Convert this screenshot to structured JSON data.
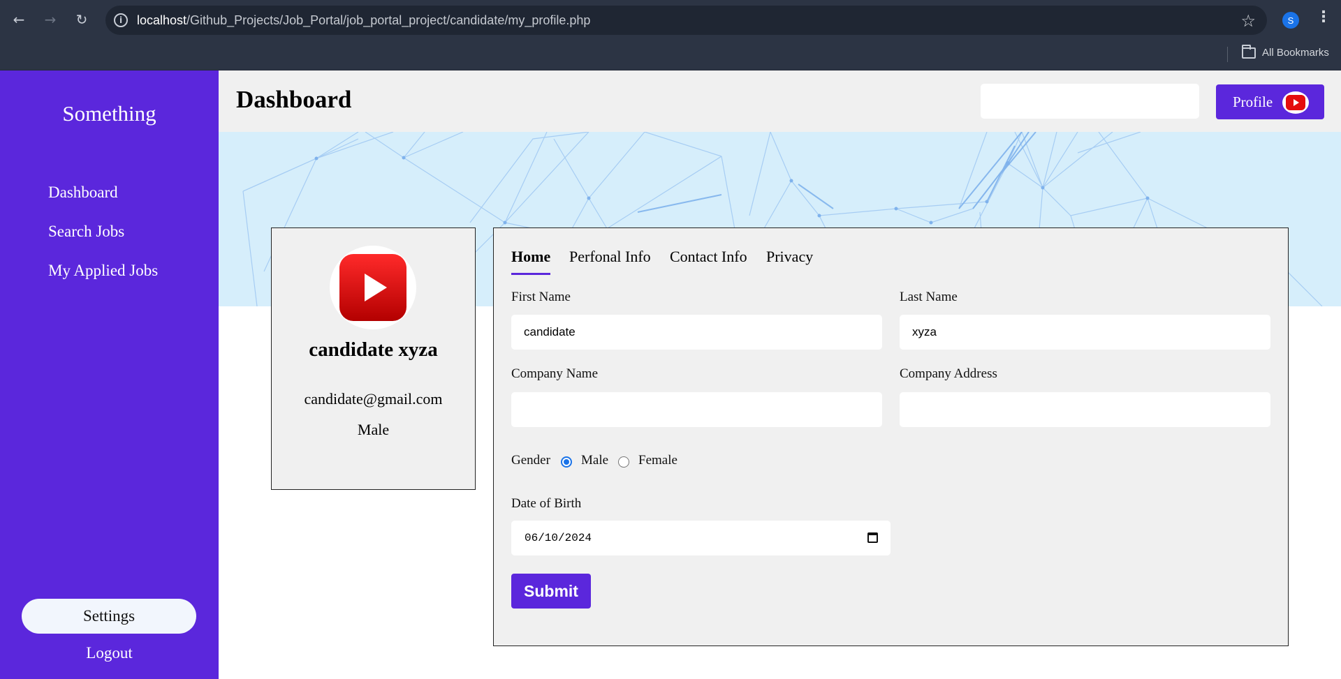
{
  "browser": {
    "url_host": "localhost",
    "url_path": "/Github_Projects/Job_Portal/job_portal_project/candidate/my_profile.php",
    "profile_initial": "S",
    "bookmarks_label": "All Bookmarks"
  },
  "sidebar": {
    "brand": "Something",
    "items": [
      {
        "label": "Dashboard"
      },
      {
        "label": "Search Jobs"
      },
      {
        "label": "My Applied Jobs"
      }
    ],
    "settings_label": "Settings",
    "logout_label": "Logout",
    "background_color": "#5b27dc"
  },
  "header": {
    "title": "Dashboard",
    "search_value": "",
    "profile_label": "Profile"
  },
  "profile_card": {
    "name": "candidate xyza",
    "email": "candidate@gmail.com",
    "gender": "Male",
    "avatar_icon": "youtube-play-icon"
  },
  "form": {
    "tabs": [
      {
        "label": "Home",
        "active": true
      },
      {
        "label": "Perfonal Info",
        "active": false
      },
      {
        "label": "Contact Info",
        "active": false
      },
      {
        "label": "Privacy",
        "active": false
      }
    ],
    "first_name_label": "First Name",
    "first_name_value": "candidate",
    "last_name_label": "Last Name",
    "last_name_value": "xyza",
    "company_name_label": "Company Name",
    "company_name_value": "",
    "company_address_label": "Company Address",
    "company_address_value": "",
    "gender_label": "Gender",
    "gender_options": [
      {
        "label": "Male",
        "checked": true
      },
      {
        "label": "Female",
        "checked": false
      }
    ],
    "dob_label": "Date of Birth",
    "dob_value": "06/10/2024",
    "submit_label": "Submit"
  },
  "colors": {
    "accent": "#5b27dc",
    "banner": "#d6eefb",
    "card_bg": "#f0f0f0"
  }
}
